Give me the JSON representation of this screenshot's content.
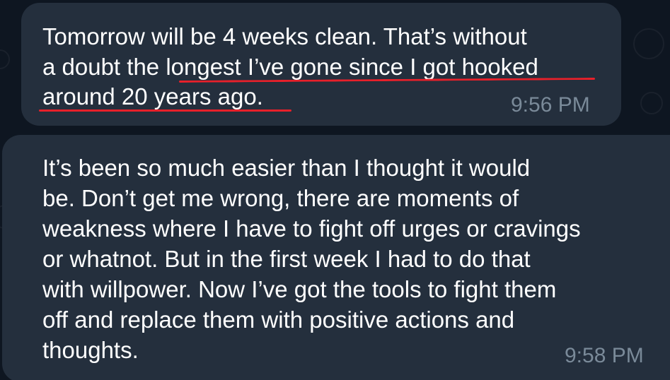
{
  "messages": [
    {
      "lines": [
        "Tomorrow will be 4 weeks clean. That’s without",
        "a doubt the longest I’ve gone since I got hooked",
        "around 20 years ago."
      ],
      "time": "9:56 PM"
    },
    {
      "lines": [
        "It’s been so much easier than I thought it would",
        "be. Don’t get me wrong, there are moments of",
        "weakness where I have to fight off urges or cravings",
        "or whatnot. But in the first week I had to do that",
        "with willpower. Now I’ve got the tools to fight them",
        "off and replace them with positive actions and",
        "thoughts."
      ],
      "time": "9:58 PM"
    }
  ],
  "colors": {
    "background": "#0e1621",
    "bubble": "#242f3d",
    "text": "#ffffff",
    "timestamp": "#7a8a99",
    "underline_annotation": "#e8202a"
  }
}
